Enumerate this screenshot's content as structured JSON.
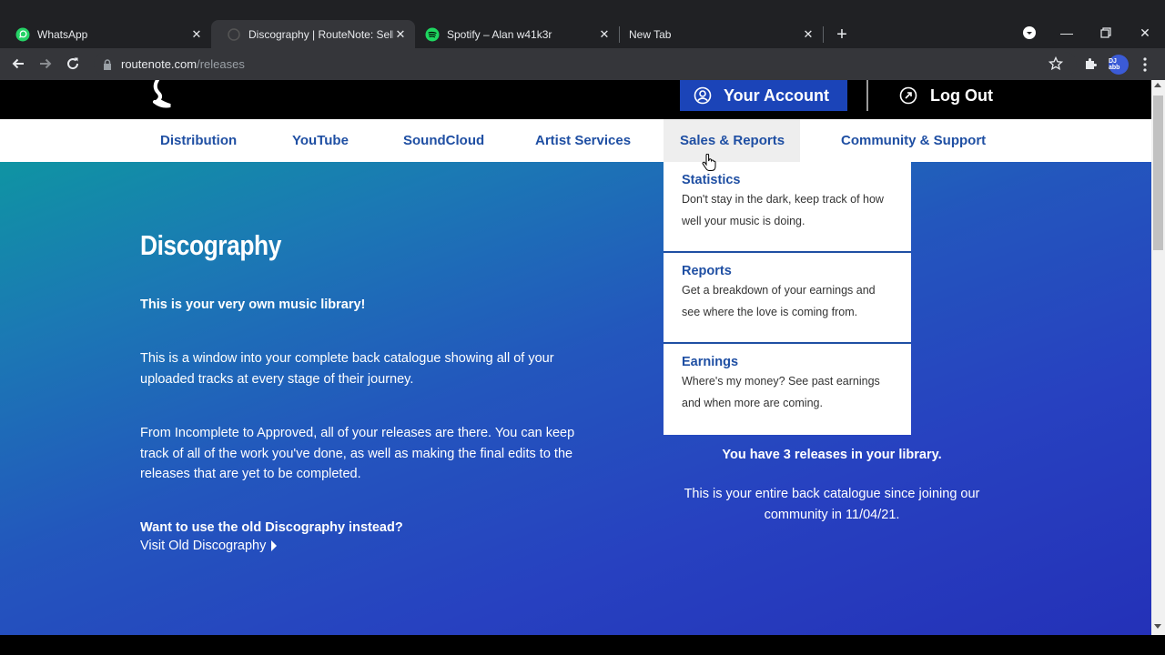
{
  "browser": {
    "tabs": [
      {
        "title": "WhatsApp",
        "icon": "whatsapp-icon",
        "active": false
      },
      {
        "title": "Discography | RouteNote: Sell Yo",
        "icon": "routenote-icon",
        "active": true
      },
      {
        "title": "Spotify – Alan w41k3r",
        "icon": "spotify-icon",
        "active": false
      },
      {
        "title": "New Tab",
        "icon": "none",
        "active": false
      }
    ],
    "url_host": "routenote.com",
    "url_path": "/releases",
    "profile_initials": "DJ abb"
  },
  "header": {
    "account_label": "Your Account",
    "logout_label": "Log Out"
  },
  "nav": {
    "items": [
      "Distribution",
      "YouTube",
      "SoundCloud",
      "Artist Services",
      "Sales & Reports",
      "Community & Support"
    ]
  },
  "dropdown": {
    "items": [
      {
        "title": "Statistics",
        "desc": "Don't stay in the dark, keep track of how well your music is doing."
      },
      {
        "title": "Reports",
        "desc": "Get a breakdown of your earnings and see where the love is coming from."
      },
      {
        "title": "Earnings",
        "desc": "Where's my money? See past earnings and when more are coming."
      }
    ]
  },
  "main": {
    "title": "Discography",
    "intro": "This is your very own music library!",
    "para1": "This is a window into your complete back catalogue showing all of your uploaded tracks at every stage of their journey.",
    "para2": "From Incomplete to Approved, all of your releases are there. You can keep track of all of the work you've done, as well as making the final edits to the releases that are yet to be completed.",
    "old_question": "Want to use the old Discography instead?",
    "old_link": "Visit Old Discography",
    "releases_count": "You have 3 releases in your library.",
    "releases_since": "This is your entire back catalogue since joining our community in 11/04/21."
  },
  "colors": {
    "brand_blue": "#1f4fa3",
    "account_button": "#1b44b8",
    "hero_gradient_start": "#0f94a3",
    "hero_gradient_end": "#2431b8"
  }
}
